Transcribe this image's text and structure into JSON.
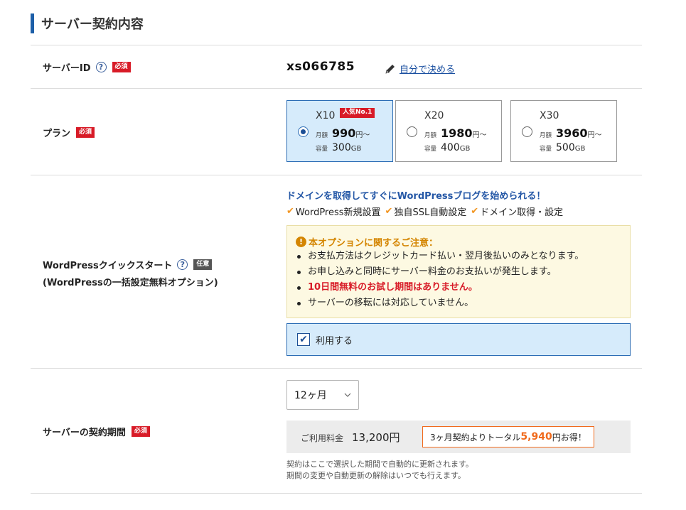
{
  "section": {
    "title": "サーバー契約内容"
  },
  "badges": {
    "required": "必須",
    "optional": "任意"
  },
  "server_id_row": {
    "label": "サーバーID",
    "value": "xs066785",
    "edit_link": "自分で決める"
  },
  "plan_row": {
    "label": "プラン",
    "popular_badge": "人気No.1",
    "month_label": "月額",
    "capacity_label": "容量",
    "price_unit": "円〜",
    "capacity_unit": "GB",
    "plans": [
      {
        "name": "X10",
        "price": "990",
        "capacity": "300",
        "selected": true
      },
      {
        "name": "X20",
        "price": "1980",
        "capacity": "400",
        "selected": false
      },
      {
        "name": "X30",
        "price": "3960",
        "capacity": "500",
        "selected": false
      }
    ]
  },
  "wordpress_row": {
    "label": "WordPressクイックスタート",
    "sublabel": "(WordPressの一括設定無料オプション)",
    "headline": "ドメインを取得してすぐにWordPressブログを始められる！",
    "features": [
      "WordPress新規設置",
      "独自SSL自動設定",
      "ドメイン取得・設定"
    ],
    "notice": {
      "title": "本オプションに関するご注意：",
      "items": [
        "お支払方法はクレジットカード払い・翌月後払いのみとなります。",
        "お申し込みと同時にサーバー料金のお支払いが発生します。",
        "10日間無料のお試し期間はありません。",
        "サーバーの移転には対応していません。"
      ]
    },
    "use_label": "利用する",
    "use_checked": true
  },
  "period_row": {
    "label": "サーバーの契約期間",
    "selected_period": "12ヶ月",
    "fee_label": "ご利用料金",
    "fee_amount": "13,200円",
    "promo_prefix": "3ヶ月契約よりトータル",
    "promo_amount": "5,940",
    "promo_suffix": "円お得！",
    "note_line1": "契約はここで選択した期間で自動的に更新されます。",
    "note_line2": "期間の変更や自動更新の解除はいつでも行えます。"
  },
  "colors": {
    "accent_blue": "#1d5fa8",
    "required_red": "#d81b27",
    "selected_bg": "#d6ebfb",
    "promo_orange": "#f06a1c",
    "notice_orange": "#d48500"
  }
}
